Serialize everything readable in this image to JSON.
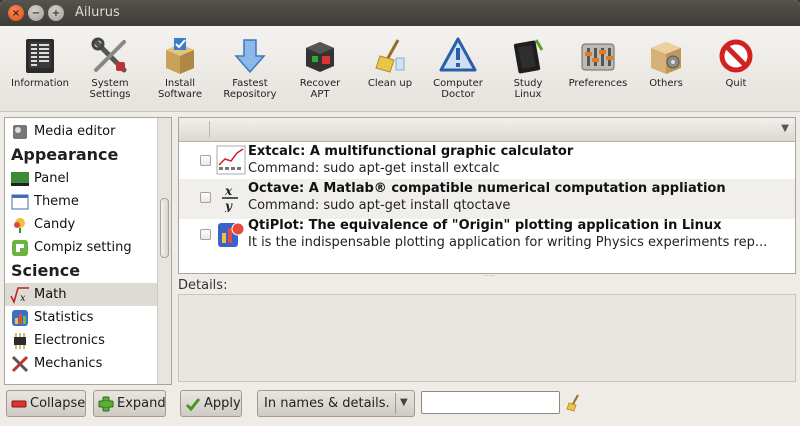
{
  "window": {
    "title": "Ailurus",
    "close_glyph": "×",
    "minimize_glyph": "−",
    "maximize_glyph": "+"
  },
  "toolbar": {
    "items": [
      {
        "label": "Information",
        "icon": "information-icon"
      },
      {
        "label": "System\nSettings",
        "icon": "system-settings-icon"
      },
      {
        "label": "Install\nSoftware",
        "icon": "install-software-icon"
      },
      {
        "label": "Fastest\nRepository",
        "icon": "fastest-repository-icon"
      },
      {
        "label": "Recover\nAPT",
        "icon": "recover-apt-icon"
      },
      {
        "label": "Clean up",
        "icon": "clean-up-icon"
      },
      {
        "label": "Computer\nDoctor",
        "icon": "computer-doctor-icon"
      },
      {
        "label": "Study\nLinux",
        "icon": "study-linux-icon"
      },
      {
        "label": "Preferences",
        "icon": "preferences-icon"
      },
      {
        "label": "Others",
        "icon": "others-icon"
      },
      {
        "label": "Quit",
        "icon": "quit-icon"
      }
    ]
  },
  "sidebar": {
    "items": [
      {
        "type": "item",
        "label": "Media editor",
        "icon": "media-editor-icon"
      },
      {
        "type": "heading",
        "label": "Appearance"
      },
      {
        "type": "item",
        "label": "Panel",
        "icon": "panel-icon"
      },
      {
        "type": "item",
        "label": "Theme",
        "icon": "theme-icon"
      },
      {
        "type": "item",
        "label": "Candy",
        "icon": "candy-icon"
      },
      {
        "type": "item",
        "label": "Compiz setting",
        "icon": "compiz-icon"
      },
      {
        "type": "heading",
        "label": "Science"
      },
      {
        "type": "item",
        "label": "Math",
        "icon": "math-icon",
        "selected": true
      },
      {
        "type": "item",
        "label": "Statistics",
        "icon": "statistics-icon"
      },
      {
        "type": "item",
        "label": "Electronics",
        "icon": "electronics-icon"
      },
      {
        "type": "item",
        "label": "Mechanics",
        "icon": "mechanics-icon"
      }
    ]
  },
  "list": {
    "rows": [
      {
        "title": "Extcalc: A multifunctional graphic calculator",
        "desc": "Command: sudo apt-get install extcalc",
        "icon": "extcalc-icon"
      },
      {
        "title": "Octave: A Matlab® compatible numerical computation appliation",
        "desc": "Command: sudo apt-get install qtoctave",
        "icon": "octave-icon"
      },
      {
        "title": "QtiPlot: The equivalence of \"Origin\" plotting application in Linux",
        "desc": "It is the indispensable plotting application for writing Physics experiments rep...",
        "icon": "qtiplot-icon"
      }
    ],
    "sort_arrow": "▼",
    "grip": "·····"
  },
  "details": {
    "label": "Details:"
  },
  "bottom": {
    "collapse_label": "Collapse",
    "expand_label": "Expand",
    "apply_label": "Apply",
    "filter_selected": "In names & details.",
    "filter_arrow": "▼",
    "search_value": ""
  }
}
